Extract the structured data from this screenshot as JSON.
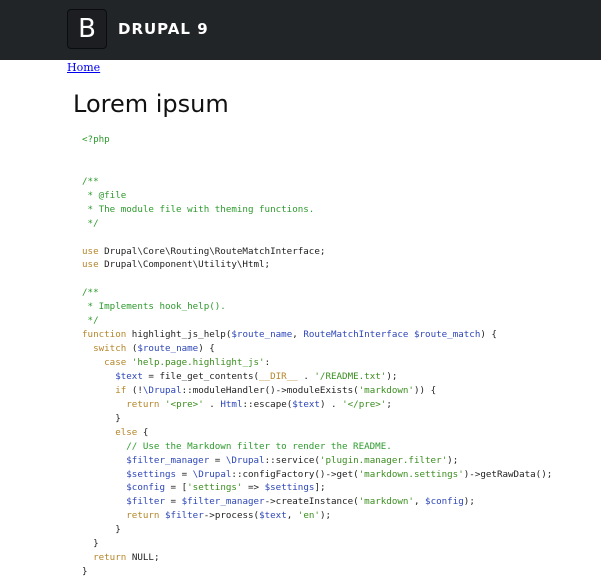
{
  "header": {
    "logo_letter": "B",
    "site_name": "DRUPAL 9",
    "background": "#222528"
  },
  "breadcrumb": {
    "home_label": "Home"
  },
  "page": {
    "title": "Lorem ipsum"
  },
  "code": {
    "lines": [
      [
        {
          "t": "<?php",
          "c": "php"
        }
      ],
      [],
      [],
      [
        {
          "t": "/**",
          "c": "c"
        }
      ],
      [
        {
          "t": " * @file",
          "c": "c"
        }
      ],
      [
        {
          "t": " * The module file with theming functions.",
          "c": "c"
        }
      ],
      [
        {
          "t": " */",
          "c": "c"
        }
      ],
      [],
      [
        {
          "t": "use",
          "c": "k"
        },
        {
          "t": " Drupal\\Core\\Routing\\RouteMatchInterface;",
          "c": "t"
        }
      ],
      [
        {
          "t": "use",
          "c": "k"
        },
        {
          "t": " Drupal\\Component\\Utility\\Html;",
          "c": "t"
        }
      ],
      [],
      [
        {
          "t": "/**",
          "c": "c"
        }
      ],
      [
        {
          "t": " * Implements hook_help().",
          "c": "c"
        }
      ],
      [
        {
          "t": " */",
          "c": "c"
        }
      ],
      [
        {
          "t": "function",
          "c": "k"
        },
        {
          "t": " highlight_js_help(",
          "c": "t"
        },
        {
          "t": "$route_name",
          "c": "v"
        },
        {
          "t": ", ",
          "c": "t"
        },
        {
          "t": "RouteMatchInterface",
          "c": "v"
        },
        {
          "t": " ",
          "c": "t"
        },
        {
          "t": "$route_match",
          "c": "v"
        },
        {
          "t": ") {",
          "c": "t"
        }
      ],
      [
        {
          "t": "  ",
          "c": "t"
        },
        {
          "t": "switch",
          "c": "k"
        },
        {
          "t": " (",
          "c": "t"
        },
        {
          "t": "$route_name",
          "c": "v"
        },
        {
          "t": ") {",
          "c": "t"
        }
      ],
      [
        {
          "t": "    ",
          "c": "t"
        },
        {
          "t": "case",
          "c": "k"
        },
        {
          "t": " ",
          "c": "t"
        },
        {
          "t": "'help.page.highlight_js'",
          "c": "s"
        },
        {
          "t": ":",
          "c": "t"
        }
      ],
      [
        {
          "t": "      ",
          "c": "t"
        },
        {
          "t": "$text",
          "c": "v"
        },
        {
          "t": " = file_get_contents(",
          "c": "t"
        },
        {
          "t": "__DIR__",
          "c": "k"
        },
        {
          "t": " . ",
          "c": "t"
        },
        {
          "t": "'/README.txt'",
          "c": "s"
        },
        {
          "t": ");",
          "c": "t"
        }
      ],
      [
        {
          "t": "      ",
          "c": "t"
        },
        {
          "t": "if",
          "c": "k"
        },
        {
          "t": " (!",
          "c": "t"
        },
        {
          "t": "\\Drupal",
          "c": "v"
        },
        {
          "t": "::moduleHandler()->moduleExists(",
          "c": "t"
        },
        {
          "t": "'markdown'",
          "c": "s"
        },
        {
          "t": ")) {",
          "c": "t"
        }
      ],
      [
        {
          "t": "        ",
          "c": "t"
        },
        {
          "t": "return",
          "c": "k"
        },
        {
          "t": " ",
          "c": "t"
        },
        {
          "t": "'<pre>'",
          "c": "s"
        },
        {
          "t": " . ",
          "c": "t"
        },
        {
          "t": "Html",
          "c": "v"
        },
        {
          "t": "::escape(",
          "c": "t"
        },
        {
          "t": "$text",
          "c": "v"
        },
        {
          "t": ") . ",
          "c": "t"
        },
        {
          "t": "'</pre>'",
          "c": "s"
        },
        {
          "t": ";",
          "c": "t"
        }
      ],
      [
        {
          "t": "      }",
          "c": "t"
        }
      ],
      [
        {
          "t": "      ",
          "c": "t"
        },
        {
          "t": "else",
          "c": "k"
        },
        {
          "t": " {",
          "c": "t"
        }
      ],
      [
        {
          "t": "        // Use the Markdown filter to render the README.",
          "c": "c"
        }
      ],
      [
        {
          "t": "        ",
          "c": "t"
        },
        {
          "t": "$filter_manager",
          "c": "v"
        },
        {
          "t": " = ",
          "c": "t"
        },
        {
          "t": "\\Drupal",
          "c": "v"
        },
        {
          "t": "::service(",
          "c": "t"
        },
        {
          "t": "'plugin.manager.filter'",
          "c": "s"
        },
        {
          "t": ");",
          "c": "t"
        }
      ],
      [
        {
          "t": "        ",
          "c": "t"
        },
        {
          "t": "$settings",
          "c": "v"
        },
        {
          "t": " = ",
          "c": "t"
        },
        {
          "t": "\\Drupal",
          "c": "v"
        },
        {
          "t": "::configFactory()->get(",
          "c": "t"
        },
        {
          "t": "'markdown.settings'",
          "c": "s"
        },
        {
          "t": ")->getRawData();",
          "c": "t"
        }
      ],
      [
        {
          "t": "        ",
          "c": "t"
        },
        {
          "t": "$config",
          "c": "v"
        },
        {
          "t": " = [",
          "c": "t"
        },
        {
          "t": "'settings'",
          "c": "s"
        },
        {
          "t": " => ",
          "c": "t"
        },
        {
          "t": "$settings",
          "c": "v"
        },
        {
          "t": "];",
          "c": "t"
        }
      ],
      [
        {
          "t": "        ",
          "c": "t"
        },
        {
          "t": "$filter",
          "c": "v"
        },
        {
          "t": " = ",
          "c": "t"
        },
        {
          "t": "$filter_manager",
          "c": "v"
        },
        {
          "t": "->createInstance(",
          "c": "t"
        },
        {
          "t": "'markdown'",
          "c": "s"
        },
        {
          "t": ", ",
          "c": "t"
        },
        {
          "t": "$config",
          "c": "v"
        },
        {
          "t": ");",
          "c": "t"
        }
      ],
      [
        {
          "t": "        ",
          "c": "t"
        },
        {
          "t": "return",
          "c": "k"
        },
        {
          "t": " ",
          "c": "t"
        },
        {
          "t": "$filter",
          "c": "v"
        },
        {
          "t": "->process(",
          "c": "t"
        },
        {
          "t": "$text",
          "c": "v"
        },
        {
          "t": ", ",
          "c": "t"
        },
        {
          "t": "'en'",
          "c": "s"
        },
        {
          "t": ");",
          "c": "t"
        }
      ],
      [
        {
          "t": "      }",
          "c": "t"
        }
      ],
      [
        {
          "t": "  }",
          "c": "t"
        }
      ],
      [
        {
          "t": "  ",
          "c": "t"
        },
        {
          "t": "return",
          "c": "k"
        },
        {
          "t": " NULL;",
          "c": "t"
        }
      ],
      [
        {
          "t": "}",
          "c": "t"
        }
      ]
    ]
  }
}
